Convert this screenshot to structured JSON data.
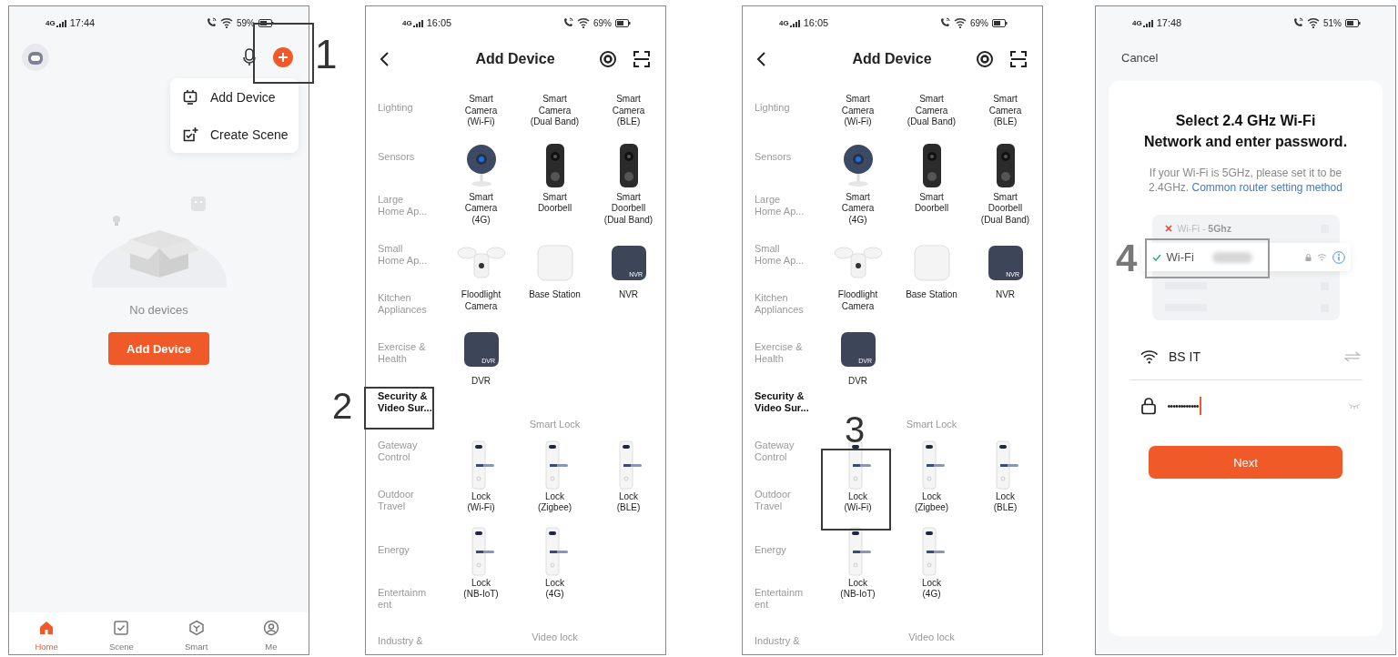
{
  "screens": [
    {
      "kind": "home",
      "step": "1",
      "status": {
        "network": "4G",
        "time": "17:44",
        "battery": "59%"
      },
      "menu": [
        {
          "label": "Add Device"
        },
        {
          "label": "Create Scene"
        }
      ],
      "empty_text": "No devices",
      "button": "Add Device",
      "tabs": [
        {
          "label": "Home",
          "selected": true
        },
        {
          "label": "Scene",
          "selected": false
        },
        {
          "label": "Smart",
          "selected": false
        },
        {
          "label": "Me",
          "selected": false
        }
      ]
    },
    {
      "kind": "add_device",
      "step": "2",
      "status": {
        "network": "4G",
        "time": "16:05",
        "battery": "69%"
      },
      "title": "Add Device",
      "categories": [
        {
          "label": "Lighting",
          "selected": false
        },
        {
          "label": "Sensors",
          "selected": false
        },
        {
          "label": "Large\nHome Ap...",
          "selected": false
        },
        {
          "label": "Small\nHome Ap...",
          "selected": false
        },
        {
          "label": "Kitchen\nAppliances",
          "selected": false
        },
        {
          "label": "Exercise &\nHealth",
          "selected": false
        },
        {
          "label": "Security &\nVideo Sur...",
          "selected": true
        },
        {
          "label": "Gateway\nControl",
          "selected": false
        },
        {
          "label": "Outdoor\nTravel",
          "selected": false
        },
        {
          "label": "Energy",
          "selected": false
        },
        {
          "label": "Entertainm\nent",
          "selected": false
        },
        {
          "label": "Industry &",
          "selected": false
        }
      ],
      "sections": [
        {
          "items": [
            {
              "label": "Smart\nCamera\n(Wi-Fi)"
            },
            {
              "label": "Smart\nCamera\n(Dual Band)"
            },
            {
              "label": "Smart\nCamera\n(BLE)"
            },
            {
              "label": "Smart\nCamera\n(4G)",
              "kind": "camera"
            },
            {
              "label": "Smart\nDoorbell",
              "kind": "doorbell"
            },
            {
              "label": "Smart\nDoorbell\n(Dual Band)",
              "kind": "doorbell"
            },
            {
              "label": "Floodlight\nCamera",
              "kind": "floodlight"
            },
            {
              "label": "Base Station",
              "kind": "base"
            },
            {
              "label": "NVR",
              "kind": "recorder",
              "badge": "NVR"
            },
            {
              "label": "DVR",
              "kind": "recorder",
              "badge": "DVR"
            }
          ]
        },
        {
          "heading": "Smart Lock",
          "items": [
            {
              "label": "Lock\n(Wi-Fi)",
              "kind": "lock"
            },
            {
              "label": "Lock\n(Zigbee)",
              "kind": "lock"
            },
            {
              "label": "Lock\n(BLE)",
              "kind": "lock"
            },
            {
              "label": "Lock\n(NB-IoT)",
              "kind": "lock"
            },
            {
              "label": "Lock\n(4G)",
              "kind": "lock"
            }
          ]
        },
        {
          "heading": "Video lock"
        }
      ]
    },
    {
      "kind": "add_device",
      "step": "3",
      "status": {
        "network": "4G",
        "time": "16:05",
        "battery": "69%"
      },
      "title": "Add Device",
      "categories": [
        {
          "label": "Lighting",
          "selected": false
        },
        {
          "label": "Sensors",
          "selected": false
        },
        {
          "label": "Large\nHome Ap...",
          "selected": false
        },
        {
          "label": "Small\nHome Ap...",
          "selected": false
        },
        {
          "label": "Kitchen\nAppliances",
          "selected": false
        },
        {
          "label": "Exercise &\nHealth",
          "selected": false
        },
        {
          "label": "Security &\nVideo Sur...",
          "selected": true
        },
        {
          "label": "Gateway\nControl",
          "selected": false
        },
        {
          "label": "Outdoor\nTravel",
          "selected": false
        },
        {
          "label": "Energy",
          "selected": false
        },
        {
          "label": "Entertainm\nent",
          "selected": false
        },
        {
          "label": "Industry &",
          "selected": false
        }
      ],
      "sections": [
        {
          "items": [
            {
              "label": "Smart\nCamera\n(Wi-Fi)"
            },
            {
              "label": "Smart\nCamera\n(Dual Band)"
            },
            {
              "label": "Smart\nCamera\n(BLE)"
            },
            {
              "label": "Smart\nCamera\n(4G)",
              "kind": "camera"
            },
            {
              "label": "Smart\nDoorbell",
              "kind": "doorbell"
            },
            {
              "label": "Smart\nDoorbell\n(Dual Band)",
              "kind": "doorbell"
            },
            {
              "label": "Floodlight\nCamera",
              "kind": "floodlight"
            },
            {
              "label": "Base Station",
              "kind": "base"
            },
            {
              "label": "NVR",
              "kind": "recorder",
              "badge": "NVR"
            },
            {
              "label": "DVR",
              "kind": "recorder",
              "badge": "DVR"
            }
          ]
        },
        {
          "heading": "Smart Lock",
          "items": [
            {
              "label": "Lock\n(Wi-Fi)",
              "kind": "lock"
            },
            {
              "label": "Lock\n(Zigbee)",
              "kind": "lock"
            },
            {
              "label": "Lock\n(BLE)",
              "kind": "lock"
            },
            {
              "label": "Lock\n(NB-IoT)",
              "kind": "lock"
            },
            {
              "label": "Lock\n(4G)",
              "kind": "lock"
            }
          ]
        },
        {
          "heading": "Video lock"
        }
      ]
    },
    {
      "kind": "wifi",
      "step": "4",
      "status": {
        "network": "4G",
        "time": "17:48",
        "battery": "51%"
      },
      "cancel": "Cancel",
      "title": "Select 2.4 GHz Wi-Fi\nNetwork and enter password.",
      "hint": "If your Wi-Fi is 5GHz, please set it to be 2.4GHz.",
      "link": "Common router setting method",
      "networks": [
        {
          "label": "Wi-Fi - **5Ghz**",
          "connected": false
        },
        {
          "label": "Wi-Fi",
          "connected": true
        }
      ],
      "wifi_field": {
        "value": "BS IT"
      },
      "password_field": {
        "value": "••••••••••••"
      },
      "button": "Next"
    }
  ]
}
